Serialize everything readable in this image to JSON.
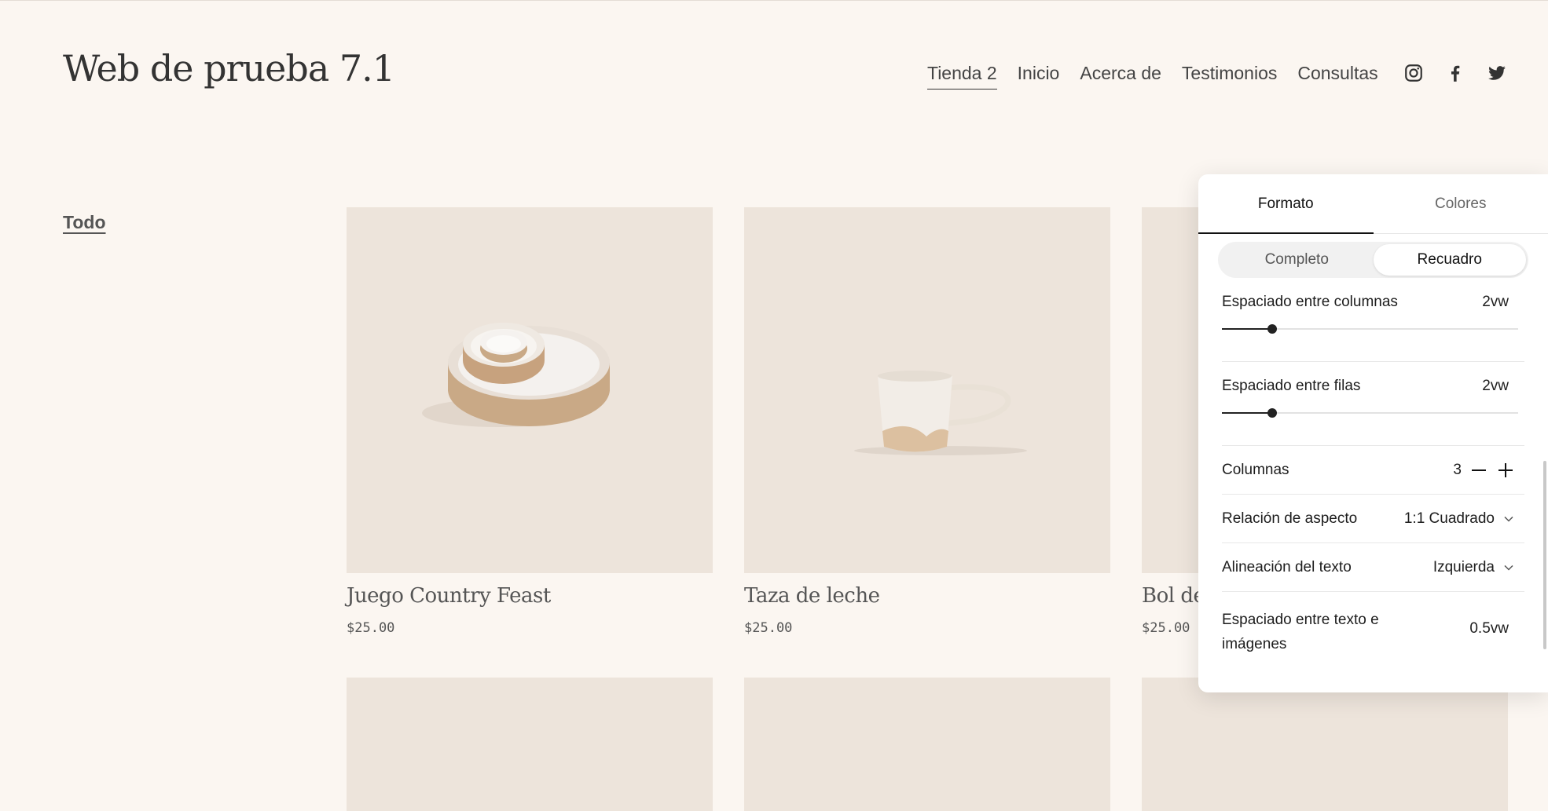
{
  "site": {
    "title": "Web de prueba 7.1"
  },
  "nav": {
    "items": [
      {
        "label": "Tienda 2",
        "active": true
      },
      {
        "label": "Inicio"
      },
      {
        "label": "Acerca de"
      },
      {
        "label": "Testimonios"
      },
      {
        "label": "Consultas"
      }
    ],
    "socials": [
      "instagram-icon",
      "facebook-icon",
      "twitter-icon"
    ]
  },
  "categories": {
    "all": "Todo"
  },
  "products": [
    {
      "name": "Juego Country Feast",
      "price": "$25.00"
    },
    {
      "name": "Taza de leche",
      "price": "$25.00"
    },
    {
      "name": "Bol de",
      "price": "$25.00"
    }
  ],
  "panel": {
    "tabs": [
      "Formato",
      "Colores"
    ],
    "active_tab": "Formato",
    "segments": [
      "Completo",
      "Recuadro"
    ],
    "active_segment": "Recuadro",
    "col_spacing": {
      "label": "Espaciado entre columnas",
      "value": "2vw",
      "level": 0.17
    },
    "row_spacing": {
      "label": "Espaciado entre filas",
      "value": "2vw",
      "level": 0.17
    },
    "columns": {
      "label": "Columnas",
      "value": "3"
    },
    "aspect": {
      "label": "Relación de aspecto",
      "value": "1:1 Cuadrado"
    },
    "text_align": {
      "label": "Alineación del texto",
      "value": "Izquierda"
    },
    "text_img_spacing": {
      "label": "Espaciado entre texto e imágenes",
      "value": "0.5vw"
    }
  },
  "colors": {
    "background": "#fbf6f1",
    "image_bg": "#ede4db",
    "accent": "#222222"
  }
}
